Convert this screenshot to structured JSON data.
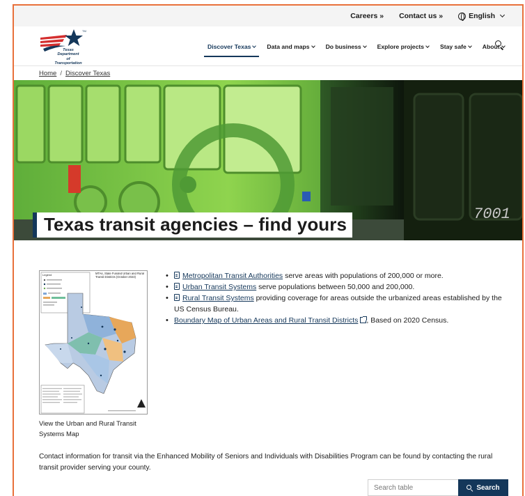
{
  "utility": {
    "careers": "Careers »",
    "contact": "Contact us »",
    "language": "English"
  },
  "logo": {
    "line1": "Texas",
    "line2": "Department",
    "line3": "of Transportation",
    "trademark": "TM"
  },
  "nav": {
    "items": [
      {
        "label": "Discover Texas"
      },
      {
        "label": "Data and maps"
      },
      {
        "label": "Do business"
      },
      {
        "label": "Explore projects"
      },
      {
        "label": "Stay safe"
      },
      {
        "label": "About"
      }
    ]
  },
  "breadcrumb": {
    "home": "Home",
    "separator": "/",
    "current": "Discover Texas"
  },
  "hero": {
    "title": "Texas transit agencies – find yours",
    "bus_number": "7001"
  },
  "map": {
    "legend_title": "Legend",
    "map_title": "MTAs, State Funded Urban and Rural Transit Districts (October 2023)",
    "caption": "View the Urban and Rural Transit Systems Map"
  },
  "links": {
    "items": [
      {
        "link": "Metropolitan Transit Authorities",
        "text": " serve areas with populations of 200,000 or more."
      },
      {
        "link": "Urban Transit Systems",
        "text": " serve populations between 50,000 and 200,000."
      },
      {
        "link": "Rural Transit Systems",
        "text": " providing coverage for areas outside the urbanized areas established by the US Census Bureau."
      },
      {
        "link": "Boundary Map of Urban Areas and Rural Transit Districts",
        "text": ", Based on 2020 Census."
      }
    ]
  },
  "contact": {
    "text": "Contact information for transit via the Enhanced Mobility of Seniors and Individuals with Disabilities Program can be found by contacting the rural transit provider serving your county."
  },
  "search": {
    "placeholder": "Search table",
    "button": "Search"
  },
  "colors": {
    "brand_navy": "#14375a",
    "frame_orange": "#e8703a",
    "bus_green": "#7ac943"
  }
}
